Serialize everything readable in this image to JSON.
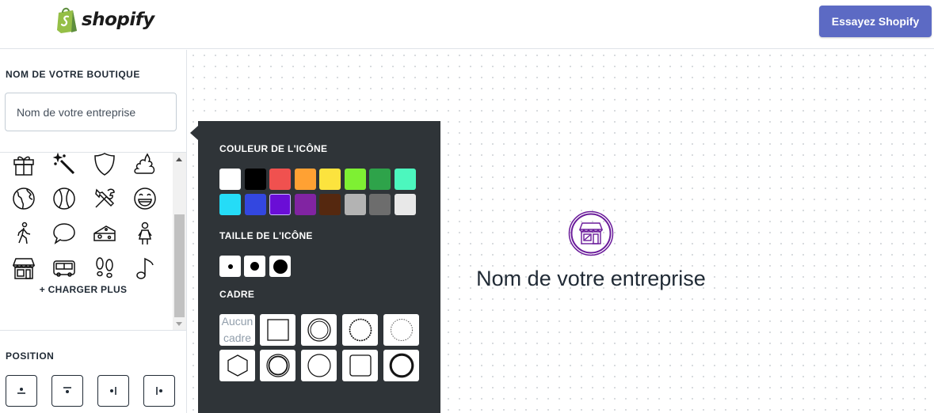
{
  "header": {
    "logo_text": "shopify",
    "cta_label": "Essayez Shopify"
  },
  "sidebar": {
    "store_name_title": "NOM DE VOTRE BOUTIQUE",
    "store_name_placeholder": "Nom de votre entreprise",
    "icons": [
      "gift-icon",
      "magic-wand-icon",
      "shield-icon",
      "poop-icon",
      "globe-icon",
      "baseball-icon",
      "tools-icon",
      "grinning-face-icon",
      "walking-person-icon",
      "speech-bubble-icon",
      "cheese-icon",
      "girl-icon",
      "storefront-icon",
      "bus-icon",
      "footprints-icon",
      "music-note-icon"
    ],
    "load_more_label": "+ CHARGER PLUS",
    "position_title": "POSITION"
  },
  "popup": {
    "color_title": "COULEUR DE L'ICÔNE",
    "colors": [
      "#ffffff",
      "#000000",
      "#f0514f",
      "#ffa133",
      "#fce33e",
      "#7ef033",
      "#2ea34a",
      "#4cf7be",
      "#25dcf7",
      "#3347e0",
      "#6a0ed6",
      "#8124a2",
      "#55280f",
      "#b3b3b3",
      "#6d6d6d",
      "#e8e8e8"
    ],
    "selected_color": "#6a0ed6",
    "size_title": "TAILLE DE L'ICÔNE",
    "frame_title": "CADRE",
    "frame_none_label_1": "Aucun",
    "frame_none_label_2": "cadre"
  },
  "preview": {
    "store_name": "Nom de votre entreprise",
    "accent_color": "#6a1b9a"
  }
}
